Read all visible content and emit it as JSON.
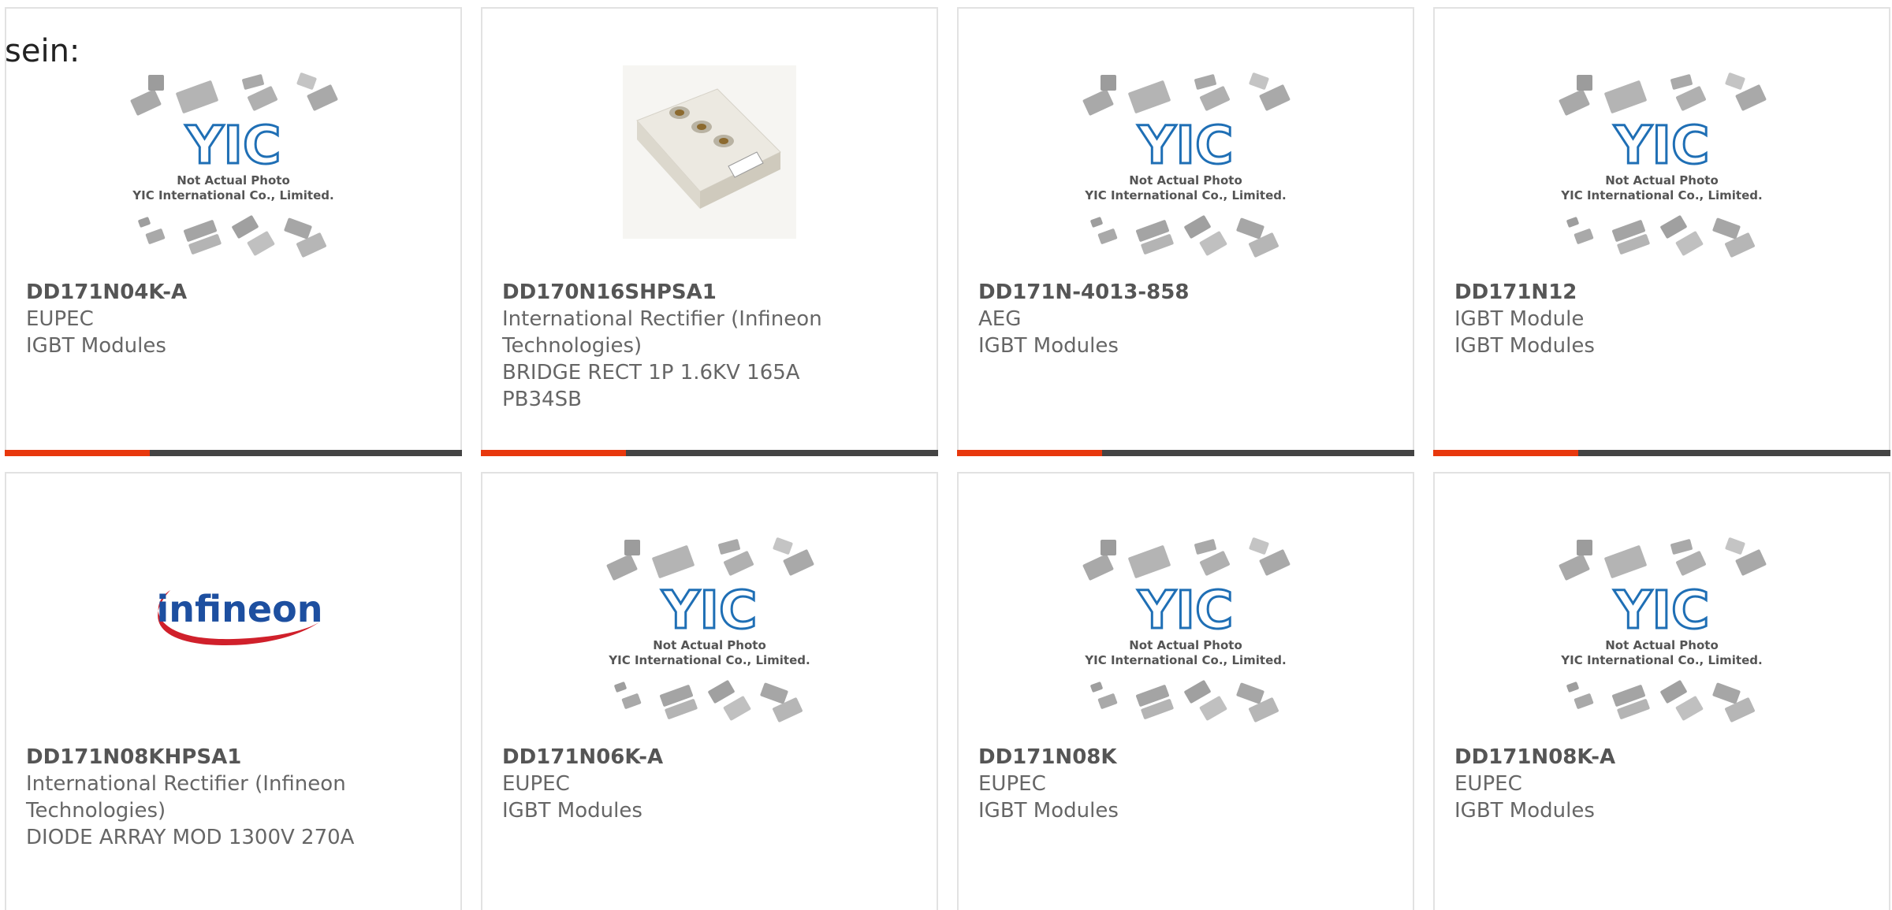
{
  "heading": "sein:",
  "placeholder": {
    "logo_text": "YIC",
    "line1": "Not Actual Photo",
    "line2": "YIC International Co., Limited."
  },
  "colors": {
    "accent": "#e8380d",
    "bar": "#444444",
    "border": "#e2e2e2",
    "yic_blue": "#1f6fb5",
    "infineon_blue": "#1d4fa0",
    "infineon_red": "#d0202b"
  },
  "products": [
    {
      "part": "DD171N04K-A",
      "lines": [
        "EUPEC",
        "IGBT Modules"
      ],
      "image": "placeholder",
      "has_bar": true
    },
    {
      "part": "DD170N16SHPSA1",
      "lines": [
        "International Rectifier (Infineon",
        "Technologies)",
        "BRIDGE RECT 1P 1.6KV 165A",
        "PB34SB"
      ],
      "image": "module-photo",
      "has_bar": true
    },
    {
      "part": "DD171N-4013-858",
      "lines": [
        "AEG",
        "IGBT Modules"
      ],
      "image": "placeholder",
      "has_bar": true
    },
    {
      "part": "DD171N12",
      "lines": [
        "IGBT Module",
        "IGBT Modules"
      ],
      "image": "placeholder",
      "has_bar": true
    },
    {
      "part": "DD171N08KHPSA1",
      "lines": [
        "International Rectifier (Infineon",
        "Technologies)",
        "DIODE ARRAY MOD 1300V 270A"
      ],
      "image": "infineon-logo",
      "has_bar": false
    },
    {
      "part": "DD171N06K-A",
      "lines": [
        "EUPEC",
        "IGBT Modules"
      ],
      "image": "placeholder",
      "has_bar": false
    },
    {
      "part": "DD171N08K",
      "lines": [
        "EUPEC",
        "IGBT Modules"
      ],
      "image": "placeholder",
      "has_bar": false
    },
    {
      "part": "DD171N08K-A",
      "lines": [
        "EUPEC",
        "IGBT Modules"
      ],
      "image": "placeholder",
      "has_bar": false
    }
  ]
}
